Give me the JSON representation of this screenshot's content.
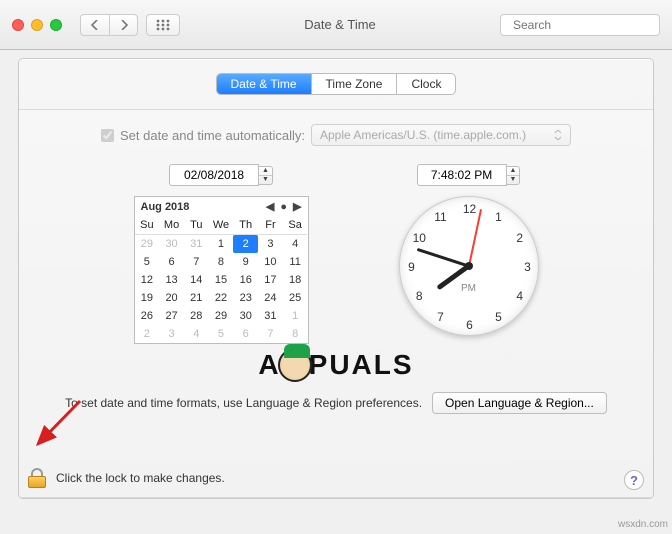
{
  "window": {
    "title": "Date & Time",
    "search_placeholder": "Search"
  },
  "tabs": [
    "Date & Time",
    "Time Zone",
    "Clock"
  ],
  "selected_tab": 0,
  "auto": {
    "label": "Set date and time automatically:",
    "server": "Apple Americas/U.S. (time.apple.com.)",
    "checked": true
  },
  "date_field": "02/08/2018",
  "time_field": "7:48:02 PM",
  "calendar": {
    "title": "Aug 2018",
    "dow": [
      "Su",
      "Mo",
      "Tu",
      "We",
      "Th",
      "Fr",
      "Sa"
    ],
    "leading": [
      29,
      30,
      31
    ],
    "days": [
      1,
      2,
      3,
      4,
      5,
      6,
      7,
      8,
      9,
      10,
      11,
      12,
      13,
      14,
      15,
      16,
      17,
      18,
      19,
      20,
      21,
      22,
      23,
      24,
      25,
      26,
      27,
      28,
      29,
      30,
      31
    ],
    "trailing": [
      1,
      2,
      3,
      4,
      5,
      6,
      7,
      8
    ],
    "selected_day": 2
  },
  "clock": {
    "numbers": [
      "12",
      "1",
      "2",
      "3",
      "4",
      "5",
      "6",
      "7",
      "8",
      "9",
      "10",
      "11"
    ],
    "ampm": "PM",
    "hour_angle": 234,
    "minute_angle": 288,
    "second_angle": 12
  },
  "watermark": "APPUALS",
  "formats_hint": "To set date and time formats, use Language & Region preferences.",
  "open_lr_btn": "Open Language & Region...",
  "lock_hint": "Click the lock to make changes.",
  "help_glyph": "?",
  "credit": "wsxdn.com"
}
